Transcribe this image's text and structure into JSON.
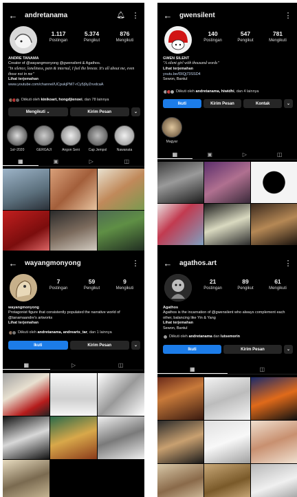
{
  "profiles": [
    {
      "username": "andretanama",
      "stats": [
        {
          "value": "1.117",
          "label": "Postingan"
        },
        {
          "value": "5.374",
          "label": "Pengikut"
        },
        {
          "value": "876",
          "label": "Mengikuti"
        }
      ],
      "name": "ANDRE TANAMA",
      "bio_line1": "Creator of @wayangmonyong @gwensilent & Agathos.",
      "bio_italic": "\"In silence, loneliness, pain & internal, I feel the breeze. It's all about me, even those not in me\"",
      "translate": "Lihat terjemahan",
      "link": "www.youtube.com/channel/UCpukjPM7-rCy5j9yZnvdcaA",
      "followed_prefix": "Diikuti oleh ",
      "followed_names": "kinikoart, hongdjienoei",
      "followed_suffix": ", dan 78 lainnya",
      "buttons": [
        "Mengikuti ⌄",
        "Kirim Pesan",
        "⌄"
      ],
      "highlights": [
        "1st~2020",
        "GERGAJI",
        "Angon Seni",
        "Cap Jempol",
        "Nawanata"
      ]
    },
    {
      "username": "gwensilent",
      "stats": [
        {
          "value": "140",
          "label": "Postingan"
        },
        {
          "value": "547",
          "label": "Pengikut"
        },
        {
          "value": "781",
          "label": "Mengikuti"
        }
      ],
      "name": "GWEN SILENT",
      "bio_italic": "\"A silent girl with thousand words\"",
      "translate": "Lihat terjemahan",
      "link": "youtu.be/f3IQj73SSD4",
      "location": "Sewon, Bantul",
      "followed_prefix": "Diikuti oleh ",
      "followed_names": "andretanama, hiwidhi",
      "followed_suffix": ", dan 4 lainnya",
      "buttons": [
        "Ikuti",
        "Kirim Pesan",
        "Kontak",
        "⌄"
      ],
      "highlights": [
        "Magyar"
      ]
    },
    {
      "username": "wayangmonyong",
      "stats": [
        {
          "value": "7",
          "label": "Postingan"
        },
        {
          "value": "59",
          "label": "Pengikut"
        },
        {
          "value": "9",
          "label": "Mengikuti"
        }
      ],
      "name": "wayangmonyong",
      "bio_line1": "Protagonist figure that consistently populated the narrative world of @tanamaandre's artworks",
      "translate": "Lihat terjemahan",
      "followed_prefix": "Diikuti oleh ",
      "followed_names": "andretanama, andrearts_tar",
      "followed_suffix": ", dan 1 lainnya",
      "buttons": [
        "Ikuti",
        "Kirim Pesan",
        "⌄"
      ]
    },
    {
      "username": "agathos.art",
      "stats": [
        {
          "value": "21",
          "label": "Postingan"
        },
        {
          "value": "89",
          "label": "Pengikut"
        },
        {
          "value": "61",
          "label": "Mengikuti"
        }
      ],
      "name": "Agathos",
      "bio_line1": "Agathos is the incarnation of @gwensilent who always complement each other, balancing like Yin & Yang",
      "translate": "Lihat terjemahan",
      "location": "Sewon, Bantul",
      "followed_prefix": "Diikuti oleh ",
      "followed_names": "andretanama",
      "followed_mid": " dan ",
      "followed_names2": "lutsemorin",
      "buttons": [
        "Ikuti",
        "Kirim Pesan",
        "⌄"
      ]
    }
  ],
  "icons": {
    "back": "back-arrow-icon",
    "bell": "bell-icon",
    "more": "more-vertical-icon",
    "grid": "grid-icon",
    "reels": "reels-icon",
    "video": "play-icon",
    "tagged": "tagged-icon"
  },
  "colors": {
    "background": "#000000",
    "button": "#262626",
    "accent": "#1c7ce8"
  }
}
